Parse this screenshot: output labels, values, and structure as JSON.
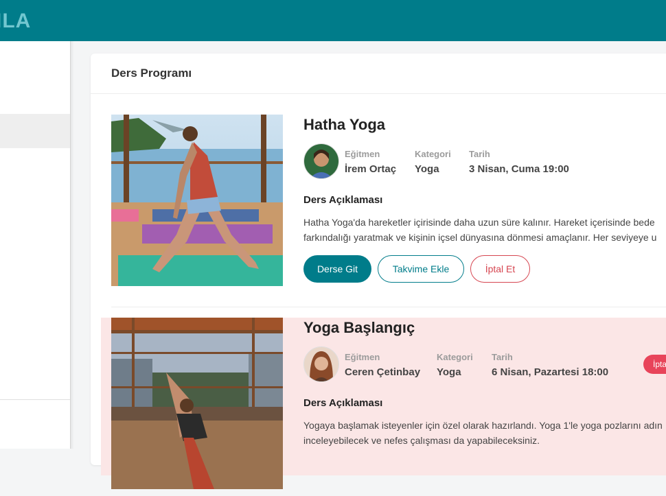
{
  "app": {
    "brand": "ILA"
  },
  "page": {
    "title": "Ders Programı"
  },
  "labels": {
    "instructor": "Eğitmen",
    "category": "Kategori",
    "date": "Tarih",
    "description": "Ders Açıklaması"
  },
  "lessons": [
    {
      "title": "Hatha Yoga",
      "instructor": "İrem Ortaç",
      "category": "Yoga",
      "date": "3 Nisan, Cuma 19:00",
      "description": "Hatha Yoga'da hareketler içirisinde daha uzun süre kalınır. Hareket içerisinde bede farkındalığı yaratmak ve kişinin içsel dünyasına dönmesi amaçlanır. Her seviyeye u",
      "buttons": {
        "go": "Derse Git",
        "calendar": "Takvime Ekle",
        "cancel": "İptal Et"
      }
    },
    {
      "title": "Yoga Başlangıç",
      "instructor": "Ceren Çetinbay",
      "category": "Yoga",
      "date": "6 Nisan, Pazartesi 18:00",
      "status": "İptal Edild",
      "description": "Yogaya başlamak isteyenler için özel olarak hazırlandı. Yoga 1'le yoga pozlarını adın inceleyebilecek ve nefes çalışması da yapabileceksiniz."
    }
  ],
  "colors": {
    "primary": "#007c8a",
    "danger": "#d64550",
    "cancelled_bg": "#fbe6e6",
    "badge": "#e8445a"
  }
}
